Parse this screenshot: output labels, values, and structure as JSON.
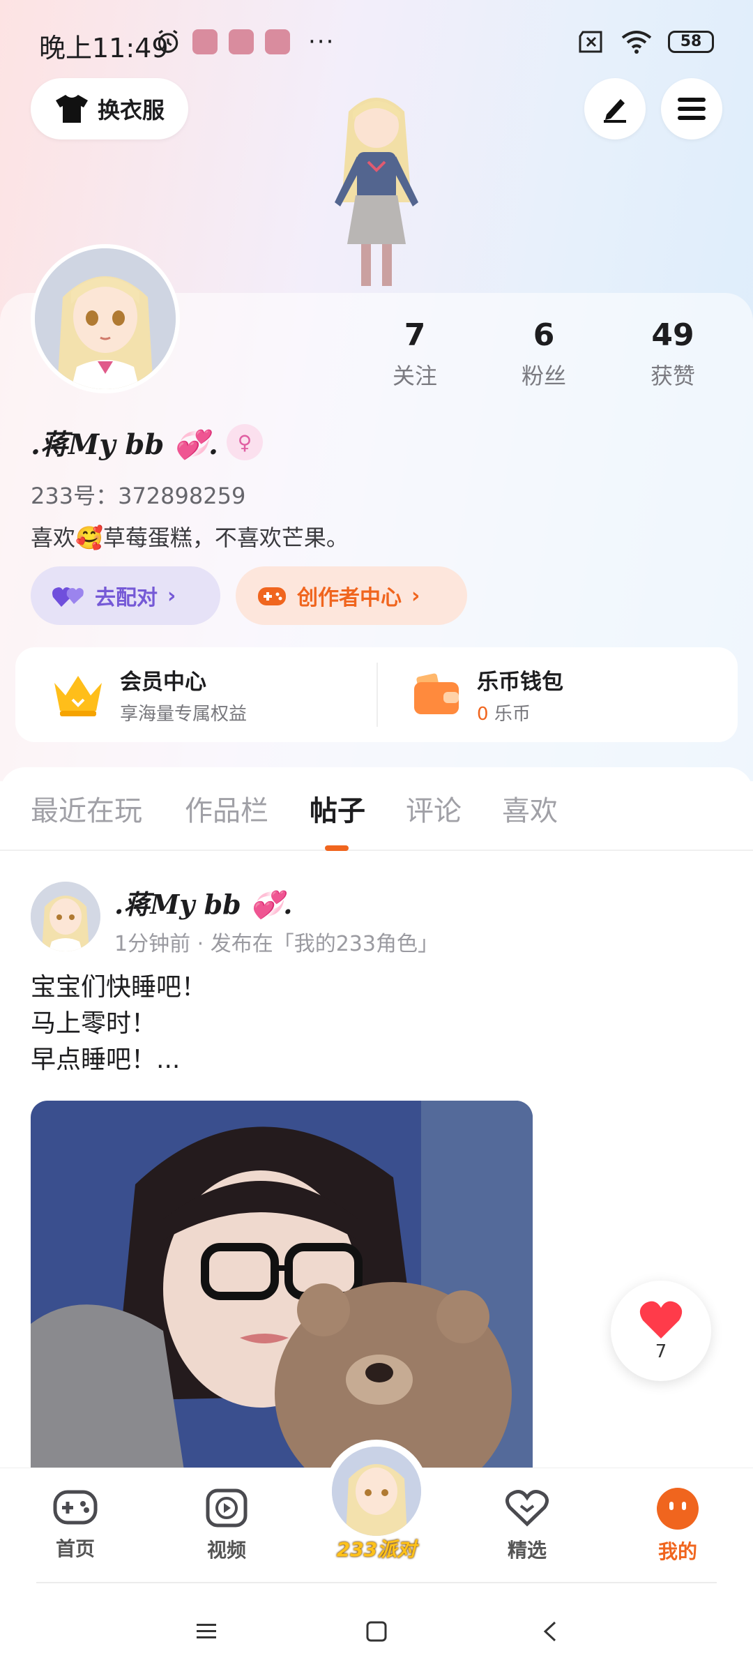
{
  "status_bar": {
    "time": "晚上11:49",
    "more": "···",
    "battery": "58"
  },
  "header": {
    "outfit_label": "换衣服"
  },
  "profile": {
    "stats": [
      {
        "value": "7",
        "label": "关注"
      },
      {
        "value": "6",
        "label": "粉丝"
      },
      {
        "value": "49",
        "label": "获赞"
      }
    ],
    "username": ".蒋My bb 💞.",
    "gender_symbol": "♀",
    "uid": "233号：372898259",
    "bio": "喜欢🥰草莓蛋糕，不喜欢芒果。",
    "pair_chip": "去配对",
    "creator_chip": "创作者中心"
  },
  "vip": {
    "member_title": "会员中心",
    "member_sub": "享海量专属权益",
    "wallet_title": "乐币钱包",
    "wallet_amount": "0",
    "wallet_unit": "乐币"
  },
  "tabs": [
    {
      "label": "最近在玩"
    },
    {
      "label": "作品栏"
    },
    {
      "label": "帖子"
    },
    {
      "label": "评论"
    },
    {
      "label": "喜欢"
    }
  ],
  "post": {
    "author": ".蒋My bb 💞.",
    "meta": "1分钟前 · 发布在「我的233角色」",
    "lines": [
      "宝宝们快睡吧！",
      "马上零时！",
      "早点睡吧！..."
    ]
  },
  "like_button": {
    "count": "7"
  },
  "bottom_nav": {
    "home": "首页",
    "video": "视频",
    "center": "233派对",
    "featured": "精选",
    "mine": "我的"
  },
  "colors": {
    "accent": "#f0651e",
    "pair_purple": "#7559d6",
    "like_red": "#ff3b4a"
  }
}
